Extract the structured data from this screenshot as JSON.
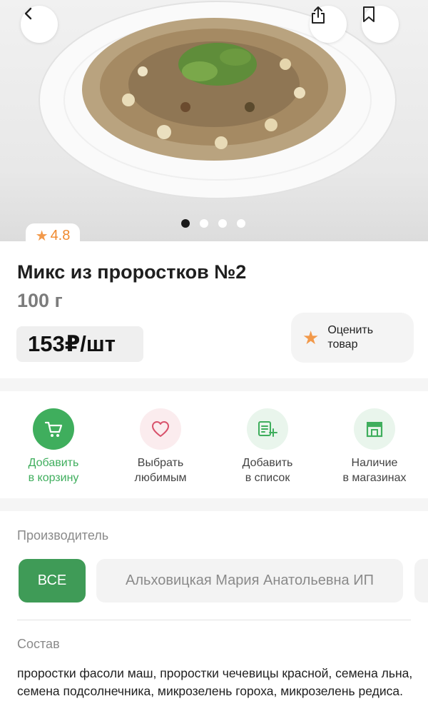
{
  "header": {
    "back_icon": "chevron-left-icon",
    "share_icon": "share-icon",
    "bookmark_icon": "bookmark-icon",
    "gallery": {
      "count": 4,
      "active_index": 0
    }
  },
  "product": {
    "rating": "4.8",
    "title": "Микс из проростков №2",
    "weight": "100 г",
    "price": "153₽/шт",
    "rate_label": "Оценить товар"
  },
  "actions": [
    {
      "label": "Добавить\nв корзину",
      "icon": "cart-icon"
    },
    {
      "label": "Выбрать\nлюбимым",
      "icon": "heart-icon"
    },
    {
      "label": "Добавить\nв список",
      "icon": "list-add-icon"
    },
    {
      "label": "Наличие\nв магазинах",
      "icon": "store-icon"
    }
  ],
  "manufacturer": {
    "heading": "Производитель",
    "all_label": "ВСЕ",
    "maker_label": "Альховицкая Мария Анатольевна ИП"
  },
  "composition": {
    "heading": "Состав",
    "text": "проростки фасоли маш, проростки чечевицы красной, семена льна, семена подсолнечника, микрозелень гороха, микрозелень редиса."
  },
  "colors": {
    "accent_green": "#3fae5d",
    "rating_orange": "#f2994a",
    "pink_bg": "#fbecee"
  }
}
